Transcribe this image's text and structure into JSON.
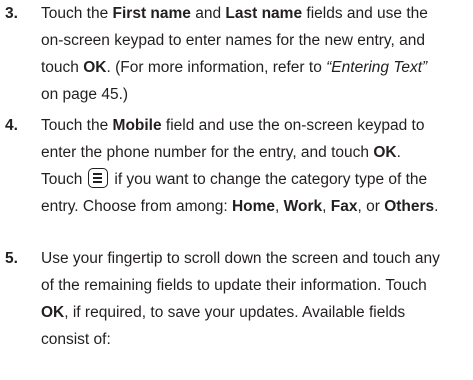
{
  "steps": [
    {
      "number": "3.",
      "lines": [
        {
          "parts": [
            {
              "t": "Touch the ",
              "s": "n"
            },
            {
              "t": "First name",
              "s": "b"
            },
            {
              "t": " and ",
              "s": "n"
            },
            {
              "t": "Last name",
              "s": "b"
            },
            {
              "t": " fields and use the",
              "s": "n"
            }
          ]
        },
        {
          "parts": [
            {
              "t": "on-screen keypad to enter names for the new entry, and",
              "s": "n"
            }
          ]
        },
        {
          "parts": [
            {
              "t": "touch ",
              "s": "n"
            },
            {
              "t": "OK",
              "s": "b"
            },
            {
              "t": ". (For more information, refer to ",
              "s": "n"
            },
            {
              "t": "“Entering Text”",
              "s": "i"
            }
          ]
        },
        {
          "parts": [
            {
              "t": "on page 45.)",
              "s": "n"
            }
          ]
        }
      ]
    },
    {
      "number": "4.",
      "lines": [
        {
          "parts": [
            {
              "t": "Touch the ",
              "s": "n"
            },
            {
              "t": "Mobile",
              "s": "b"
            },
            {
              "t": " field and use the on-screen keypad to",
              "s": "n"
            }
          ]
        },
        {
          "parts": [
            {
              "t": "enter the phone number for the entry, and touch ",
              "s": "n"
            },
            {
              "t": "OK",
              "s": "b"
            },
            {
              "t": ".",
              "s": "n"
            }
          ]
        },
        {
          "parts": [
            {
              "t": "Touch",
              "s": "n"
            },
            {
              "t": "menu-icon",
              "s": "icon"
            },
            {
              "t": "if you want to change the category type of the",
              "s": "n"
            }
          ]
        },
        {
          "parts": [
            {
              "t": "entry. Choose from among: ",
              "s": "n"
            },
            {
              "t": "Home",
              "s": "b"
            },
            {
              "t": ", ",
              "s": "n"
            },
            {
              "t": "Work",
              "s": "b"
            },
            {
              "t": ", ",
              "s": "n"
            },
            {
              "t": "Fax",
              "s": "b"
            },
            {
              "t": ", or ",
              "s": "n"
            },
            {
              "t": "Others",
              "s": "b"
            },
            {
              "t": ".",
              "s": "n"
            }
          ]
        }
      ]
    },
    {
      "number": "5.",
      "lines": [
        {
          "parts": [
            {
              "t": "Use your fingertip to scroll down the screen and touch any",
              "s": "n"
            }
          ]
        },
        {
          "parts": [
            {
              "t": "of the remaining fields to update their information. Touch",
              "s": "n"
            }
          ]
        },
        {
          "parts": [
            {
              "t": "OK",
              "s": "b"
            },
            {
              "t": ", if required, to save your updates. Available fields",
              "s": "n"
            }
          ]
        },
        {
          "parts": [
            {
              "t": "consist of:",
              "s": "n"
            }
          ]
        }
      ]
    }
  ]
}
